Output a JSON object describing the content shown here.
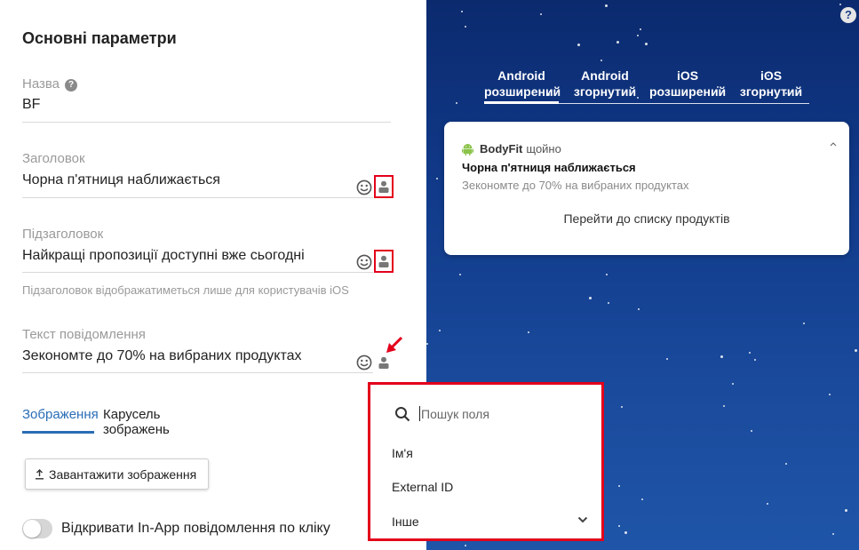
{
  "form": {
    "section_title": "Основні параметри",
    "name": {
      "label": "Назва",
      "value": "BF"
    },
    "title": {
      "label": "Заголовок",
      "value": "Чорна п'ятниця наближається"
    },
    "subtitle": {
      "label": "Підзаголовок",
      "value": "Найкращі пропозиції доступні вже сьогодні",
      "hint": "Підзаголовок відображатиметься лише для користувачів iOS"
    },
    "message": {
      "label": "Текст повідомлення",
      "value": "Зекономте до 70% на вибраних продуктах"
    },
    "image_tabs": [
      "Зображення",
      "Карусель зображень"
    ],
    "upload_label": "Завантажити зображення",
    "toggle_label": "Відкривати In-App повідомлення по кліку"
  },
  "preview": {
    "tabs": [
      {
        "line1": "Android",
        "line2": "розширений"
      },
      {
        "line1": "Android",
        "line2": "згорнутий"
      },
      {
        "line1": "iOS",
        "line2": "розширений"
      },
      {
        "line1": "iOS",
        "line2": "згорнутий"
      }
    ],
    "notification": {
      "app_name": "BodyFit",
      "time": "щойно",
      "title": "Чорна п'ятниця наближається",
      "body": "Зекономте до 70% на вибраних продуктах",
      "action": "Перейти до списку продуктів"
    },
    "help_glyph": "?"
  },
  "field_dropdown": {
    "search_placeholder": "Пошук поля",
    "items": [
      "Ім'я",
      "External ID",
      "Інше"
    ]
  },
  "colors": {
    "accent": "#2a6db5",
    "highlight": "#e3001b",
    "preview_bg": "#113a8a"
  }
}
